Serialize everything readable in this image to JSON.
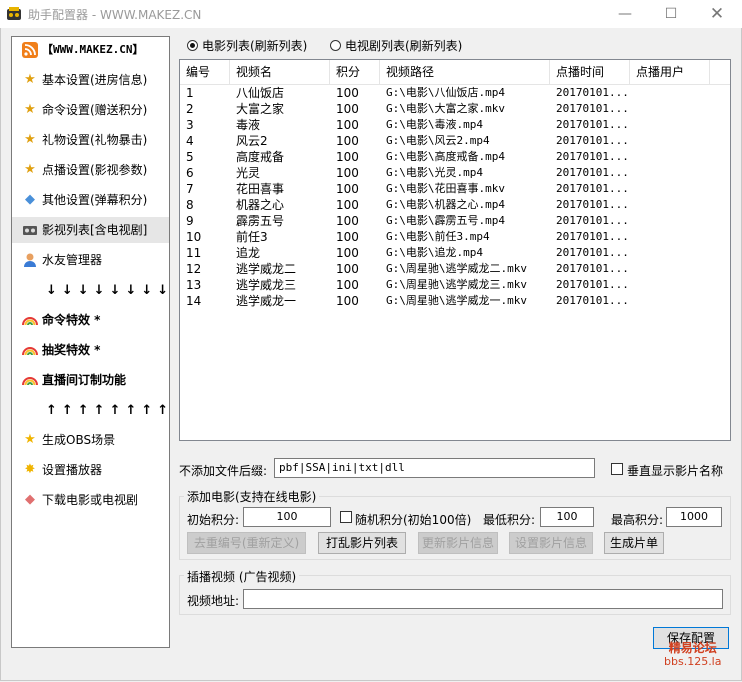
{
  "window": {
    "title": "助手配置器 - WWW.MAKEZ.CN",
    "minimize": "—",
    "maximize": "☐",
    "close": "✕"
  },
  "sidebar": {
    "items": [
      {
        "label": "【WWW.MAKEZ.CN】",
        "icon": "rss-icon"
      },
      {
        "label": "基本设置(进房信息)",
        "icon": "medal-icon"
      },
      {
        "label": "命令设置(赠送积分)",
        "icon": "medal-icon"
      },
      {
        "label": "礼物设置(礼物暴击)",
        "icon": "medal-icon"
      },
      {
        "label": "点播设置(影视参数)",
        "icon": "medal-icon"
      },
      {
        "label": "其他设置(弹幕积分)",
        "icon": "tag-icon"
      },
      {
        "label": "影视列表[含电视剧]",
        "icon": "film-icon"
      },
      {
        "label": "水友管理器",
        "icon": "user-icon"
      },
      {
        "label": "命令特效 *",
        "icon": "rainbow-icon"
      },
      {
        "label": "抽奖特效 *",
        "icon": "rainbow-icon"
      },
      {
        "label": "直播间订制功能",
        "icon": "rainbow-icon"
      },
      {
        "label": "生成OBS场景",
        "icon": "star-icon"
      },
      {
        "label": "设置播放器",
        "icon": "sparkle-icon"
      },
      {
        "label": "下载电影或电视剧",
        "icon": "tag-icon"
      }
    ],
    "arrows_down": "↓↓↓↓↓↓↓↓",
    "arrows_up": "↑↑↑↑↑↑↑↑"
  },
  "mode": {
    "movie": "电影列表(刷新列表)",
    "tv": "电视剧列表(刷新列表)"
  },
  "table": {
    "columns": [
      "编号",
      "视频名",
      "积分",
      "视频路径",
      "点播时间",
      "点播用户"
    ],
    "rows": [
      [
        "1",
        "八仙饭店",
        "100",
        "G:\\电影\\八仙饭店.mp4",
        "20170101...",
        ""
      ],
      [
        "2",
        "大富之家",
        "100",
        "G:\\电影\\大富之家.mkv",
        "20170101...",
        ""
      ],
      [
        "3",
        "毒液",
        "100",
        "G:\\电影\\毒液.mp4",
        "20170101...",
        ""
      ],
      [
        "4",
        "风云2",
        "100",
        "G:\\电影\\风云2.mp4",
        "20170101...",
        ""
      ],
      [
        "5",
        "高度戒备",
        "100",
        "G:\\电影\\高度戒备.mp4",
        "20170101...",
        ""
      ],
      [
        "6",
        "光灵",
        "100",
        "G:\\电影\\光灵.mp4",
        "20170101...",
        ""
      ],
      [
        "7",
        "花田喜事",
        "100",
        "G:\\电影\\花田喜事.mkv",
        "20170101...",
        ""
      ],
      [
        "8",
        "机器之心",
        "100",
        "G:\\电影\\机器之心.mp4",
        "20170101...",
        ""
      ],
      [
        "9",
        "霹雳五号",
        "100",
        "G:\\电影\\霹雳五号.mp4",
        "20170101...",
        ""
      ],
      [
        "10",
        "前任3",
        "100",
        "G:\\电影\\前任3.mp4",
        "20170101...",
        ""
      ],
      [
        "11",
        "追龙",
        "100",
        "G:\\电影\\追龙.mp4",
        "20170101...",
        ""
      ],
      [
        "12",
        "逃学威龙二",
        "100",
        "G:\\周星驰\\逃学威龙二.mkv",
        "20170101...",
        ""
      ],
      [
        "13",
        "逃学威龙三",
        "100",
        "G:\\周星驰\\逃学威龙三.mkv",
        "20170101...",
        ""
      ],
      [
        "14",
        "逃学威龙一",
        "100",
        "G:\\周星驰\\逃学威龙一.mkv",
        "20170101...",
        ""
      ]
    ]
  },
  "filter": {
    "label": "不添加文件后缀:",
    "value": "pbf|SSA|ini|txt|dll",
    "vertical_label": "垂直显示影片名称"
  },
  "add_movie": {
    "title": "添加电影(支持在线电影)",
    "initial_label": "初始积分:",
    "initial_value": "100",
    "random_label": "随机积分(初始100倍)",
    "min_label": "最低积分:",
    "min_value": "100",
    "max_label": "最高积分:",
    "max_value": "1000",
    "buttons": {
      "renumber": "去重编号(重新定义)",
      "shuffle": "打乱影片列表",
      "update": "更新影片信息",
      "setinfo": "设置影片信息",
      "generate": "生成片单"
    }
  },
  "ad": {
    "title": "插播视频 (广告视频)",
    "url_label": "视频地址:",
    "url_value": ""
  },
  "save_button": "保存配置",
  "watermark": {
    "line1": "精易论坛",
    "line2": "bbs.125.la"
  }
}
